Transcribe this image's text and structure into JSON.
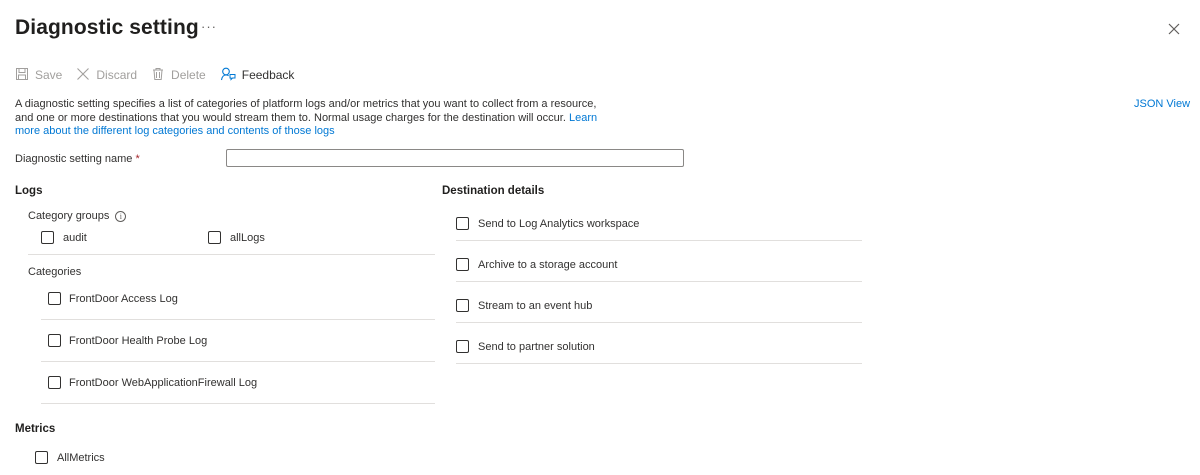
{
  "header": {
    "title": "Diagnostic setting",
    "more_label": "···"
  },
  "toolbar": {
    "save_label": "Save",
    "discard_label": "Discard",
    "delete_label": "Delete",
    "feedback_label": "Feedback"
  },
  "description": {
    "line1": "A diagnostic setting specifies a list of categories of platform logs and/or metrics that you want to collect from a resource,",
    "line2_text": "and one or more destinations that you would stream them to. Normal usage charges for the destination will occur.",
    "line2_link": "Learn",
    "line3_link": "more about the different log categories and contents of those logs"
  },
  "json_view_label": "JSON View",
  "setting_name": {
    "label": "Diagnostic setting name",
    "required_mark": "*",
    "value": "",
    "placeholder": ""
  },
  "logs": {
    "heading": "Logs",
    "category_groups_label": "Category groups",
    "info_icon": "ⓘ",
    "groups": [
      {
        "label": "audit",
        "checked": false
      },
      {
        "label": "allLogs",
        "checked": false
      }
    ],
    "categories_label": "Categories",
    "categories": [
      {
        "label": "FrontDoor Access Log",
        "checked": false
      },
      {
        "label": "FrontDoor Health Probe Log",
        "checked": false
      },
      {
        "label": "FrontDoor WebApplicationFirewall Log",
        "checked": false
      }
    ]
  },
  "destination": {
    "heading": "Destination details",
    "options": [
      {
        "label": "Send to Log Analytics workspace",
        "checked": false
      },
      {
        "label": "Archive to a storage account",
        "checked": false
      },
      {
        "label": "Stream to an event hub",
        "checked": false
      },
      {
        "label": "Send to partner solution",
        "checked": false
      }
    ]
  },
  "metrics": {
    "heading": "Metrics",
    "items": [
      {
        "label": "AllMetrics",
        "checked": false
      }
    ]
  },
  "colors": {
    "link": "#0078d4",
    "disabled_text": "#a19f9d",
    "required": "#a4262c",
    "divider": "#e1dfdd"
  }
}
